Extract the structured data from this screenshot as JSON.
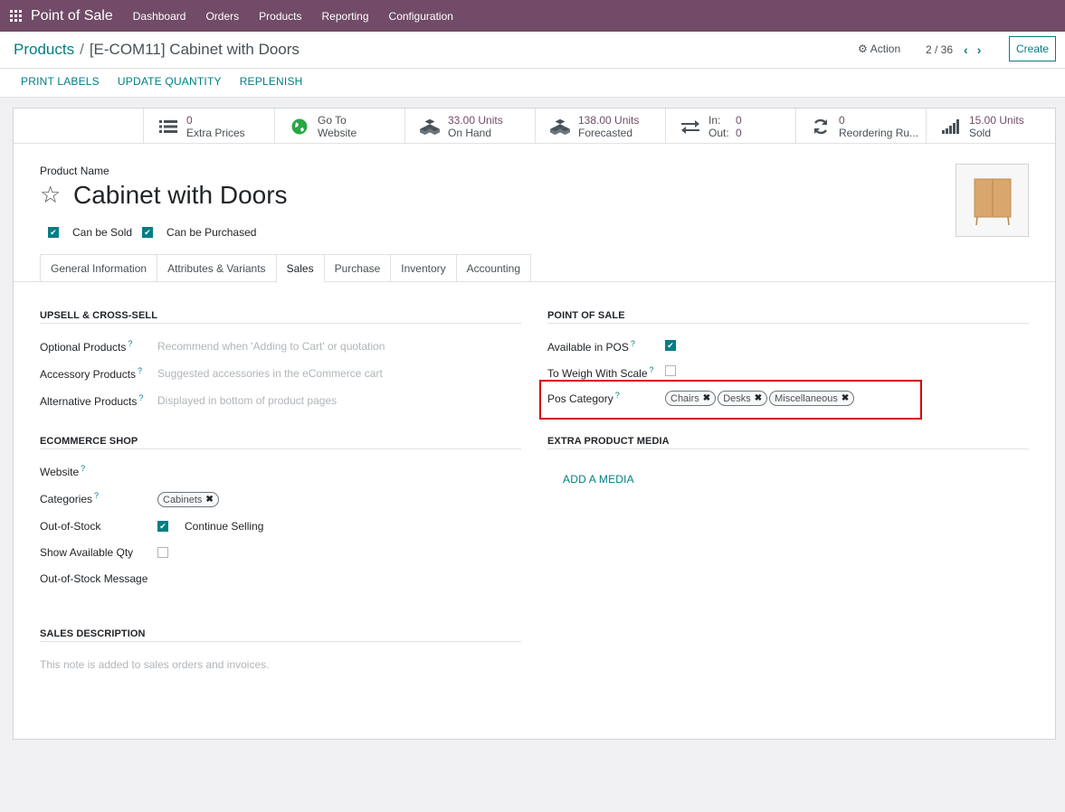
{
  "navbar": {
    "app_name": "Point of Sale",
    "menu": [
      "Dashboard",
      "Orders",
      "Products",
      "Reporting",
      "Configuration"
    ],
    "bg_color": "#714B67"
  },
  "breadcrumb": {
    "parent": "Products",
    "separator": "/",
    "current": "[E-COM11] Cabinet with Doors"
  },
  "toolbar": {
    "action_label": "Action",
    "pager": "2 / 36",
    "create_label": "Create"
  },
  "header_buttons": [
    "PRINT LABELS",
    "UPDATE QUANTITY",
    "REPLENISH"
  ],
  "stats": {
    "extra_prices": {
      "value": "0",
      "label": "Extra Prices",
      "icon": "list-icon"
    },
    "website": {
      "line1": "Go To",
      "line2": "Website",
      "icon": "globe-icon"
    },
    "on_hand": {
      "value": "33.00 Units",
      "label": "On Hand",
      "icon": "cubes-icon"
    },
    "forecasted": {
      "value": "138.00 Units",
      "label": "Forecasted",
      "icon": "cubes-icon"
    },
    "in_out": {
      "in_label": "In:",
      "in_value": "0",
      "out_label": "Out:",
      "out_value": "0",
      "icon": "exchange-icon"
    },
    "reordering": {
      "value": "0",
      "label": "Reordering Ru...",
      "icon": "refresh-icon"
    },
    "sold": {
      "value": "15.00 Units",
      "label": "Sold",
      "icon": "signal-icon"
    }
  },
  "product": {
    "name_label": "Product Name",
    "name": "Cabinet with Doors",
    "can_be_sold": "Can be Sold",
    "can_be_purchased": "Can be Purchased"
  },
  "tabs": [
    "General Information",
    "Attributes & Variants",
    "Sales",
    "Purchase",
    "Inventory",
    "Accounting"
  ],
  "upsell": {
    "title": "UPSELL & CROSS-SELL",
    "optional_label": "Optional Products",
    "optional_placeholder": "Recommend when 'Adding to Cart' or quotation",
    "accessory_label": "Accessory Products",
    "accessory_placeholder": "Suggested accessories in the eCommerce cart",
    "alternative_label": "Alternative Products",
    "alternative_placeholder": "Displayed in bottom of product pages"
  },
  "pos": {
    "title": "POINT OF SALE",
    "available_label": "Available in POS",
    "weigh_label": "To Weigh With Scale",
    "category_label": "Pos Category",
    "categories": [
      "Chairs",
      "Desks",
      "Miscellaneous"
    ]
  },
  "ecommerce": {
    "title": "ECOMMERCE SHOP",
    "website_label": "Website",
    "categories_label": "Categories",
    "category_tag": "Cabinets",
    "oos_label": "Out-of-Stock",
    "continue_selling": "Continue Selling",
    "show_qty_label": "Show Available Qty",
    "oos_message_label": "Out-of-Stock Message"
  },
  "extra_media": {
    "title": "EXTRA PRODUCT MEDIA",
    "add_label": "ADD A MEDIA"
  },
  "sales_description": {
    "title": "SALES DESCRIPTION",
    "placeholder": "This note is added to sales orders and invoices."
  },
  "help_mark": "?",
  "remove_mark": "✖"
}
